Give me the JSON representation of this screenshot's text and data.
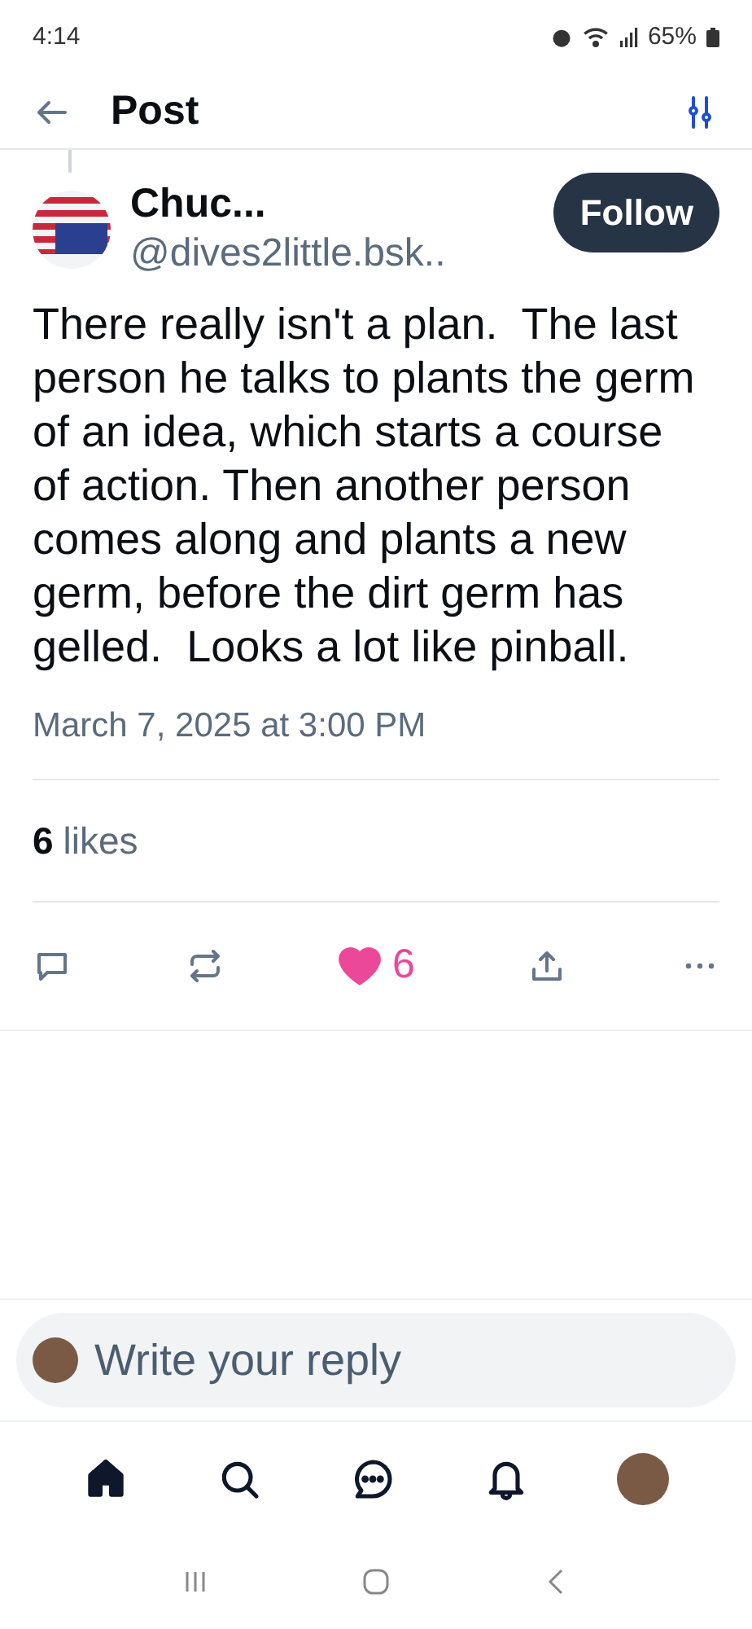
{
  "status_bar": {
    "time": "4:14",
    "battery": "65%"
  },
  "header": {
    "title": "Post"
  },
  "post": {
    "author_name": "Chuc...",
    "handle": "@dives2little.bsk..",
    "follow_label": "Follow",
    "text": "There really isn't a plan.  The last person he talks to plants the germ of an idea, which starts a course of action. Then another person comes along and plants a new germ, before the dirt germ has gelled.  Looks a lot like pinball.",
    "timestamp": "March 7, 2025 at 3:00 PM",
    "likes_count": "6",
    "likes_label": "likes",
    "liked": true,
    "like_count": "6"
  },
  "reply": {
    "placeholder": "Write your reply"
  },
  "bottom_nav": [
    {
      "kind": "home",
      "selected": true
    },
    {
      "kind": "search",
      "selected": false
    },
    {
      "kind": "chat",
      "selected": false
    },
    {
      "kind": "notifications",
      "selected": false
    },
    {
      "kind": "profile",
      "selected": false
    }
  ]
}
